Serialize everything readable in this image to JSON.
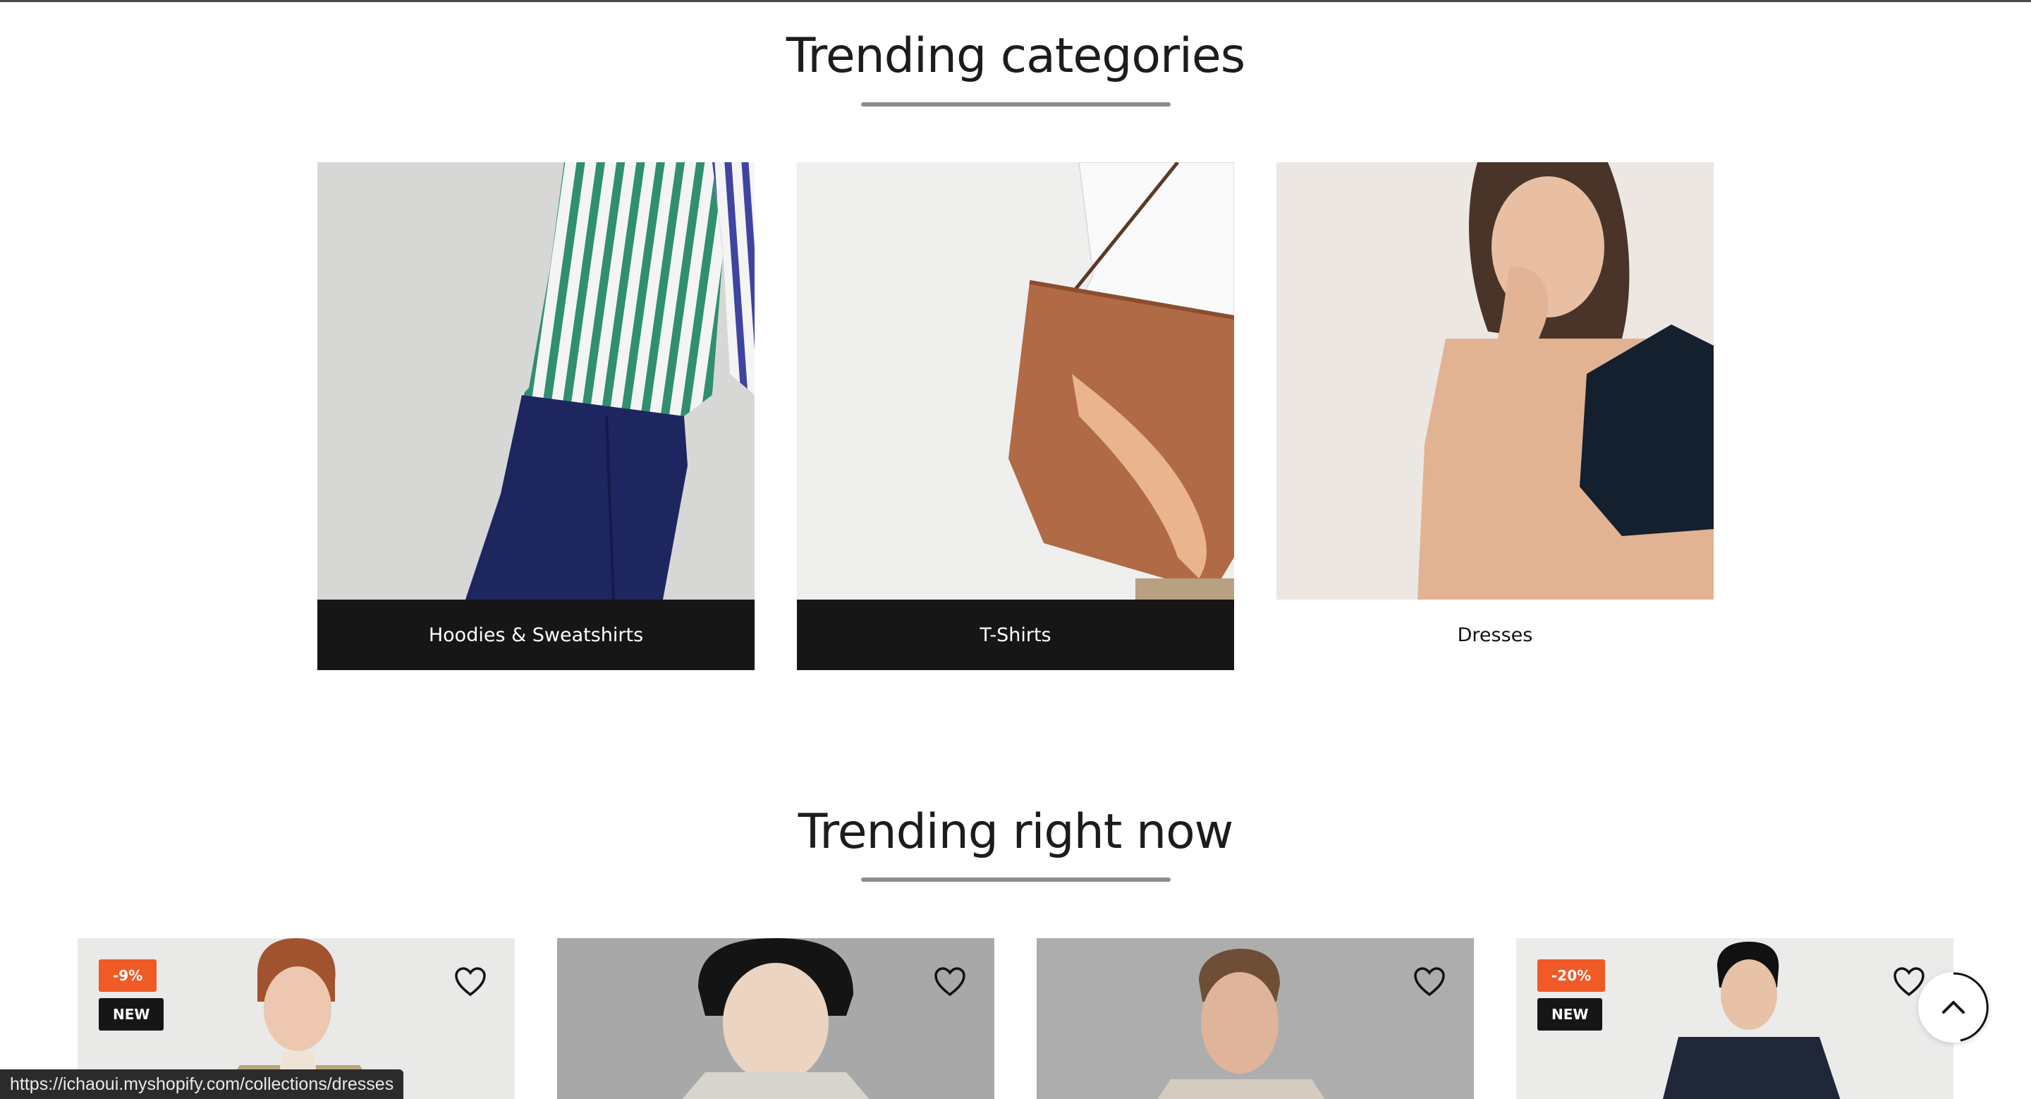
{
  "trending_categories": {
    "title": "Trending categories",
    "items": [
      {
        "label": "Hoodies & Sweatshirts",
        "style": "dark"
      },
      {
        "label": "T-Shirts",
        "style": "dark"
      },
      {
        "label": "Dresses",
        "style": "light"
      }
    ]
  },
  "trending_now": {
    "title": "Trending right now",
    "products": [
      {
        "sale_badge": "-9%",
        "new_badge": "NEW"
      },
      {
        "sale_badge": "",
        "new_badge": ""
      },
      {
        "sale_badge": "",
        "new_badge": ""
      },
      {
        "sale_badge": "-20%",
        "new_badge": "NEW"
      }
    ]
  },
  "status_bar": {
    "url": "https://ichaoui.myshopify.com/collections/dresses"
  },
  "colors": {
    "sale_badge": "#ef5a26",
    "dark_label": "#161616",
    "underline": "#8c8c8c"
  },
  "icons": {
    "wishlist": "heart-outline-icon",
    "back_to_top": "chevron-up-icon"
  }
}
